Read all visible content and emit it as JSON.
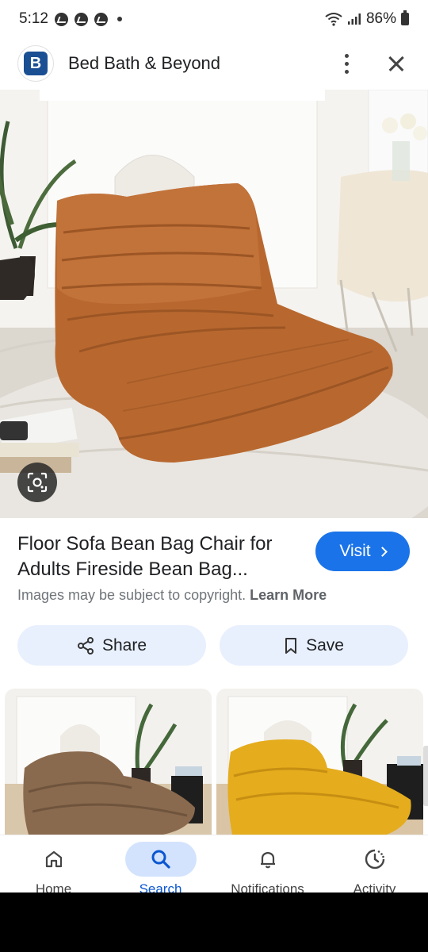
{
  "status_bar": {
    "time": "5:12",
    "battery": "86%"
  },
  "header": {
    "favicon_letter": "B",
    "site_name": "Bed Bath & Beyond"
  },
  "result": {
    "title": "Floor Sofa Bean Bag Chair for Adults Fireside Bean Bag...",
    "visit_label": "Visit",
    "copyright_text": "Images may be subject to copyright.",
    "learn_more": "Learn More",
    "share_label": "Share",
    "save_label": "Save"
  },
  "nav": {
    "items": [
      {
        "label": "Home",
        "icon": "home-icon"
      },
      {
        "label": "Search",
        "icon": "search-icon"
      },
      {
        "label": "Notifications",
        "icon": "bell-icon"
      },
      {
        "label": "Activity",
        "icon": "activity-icon"
      }
    ],
    "active": "Search"
  },
  "colors": {
    "accent": "#1a73e8",
    "pill_bg": "#e8f0fe",
    "nav_active": "#d3e3fd",
    "chair_main": "#b8682f"
  }
}
